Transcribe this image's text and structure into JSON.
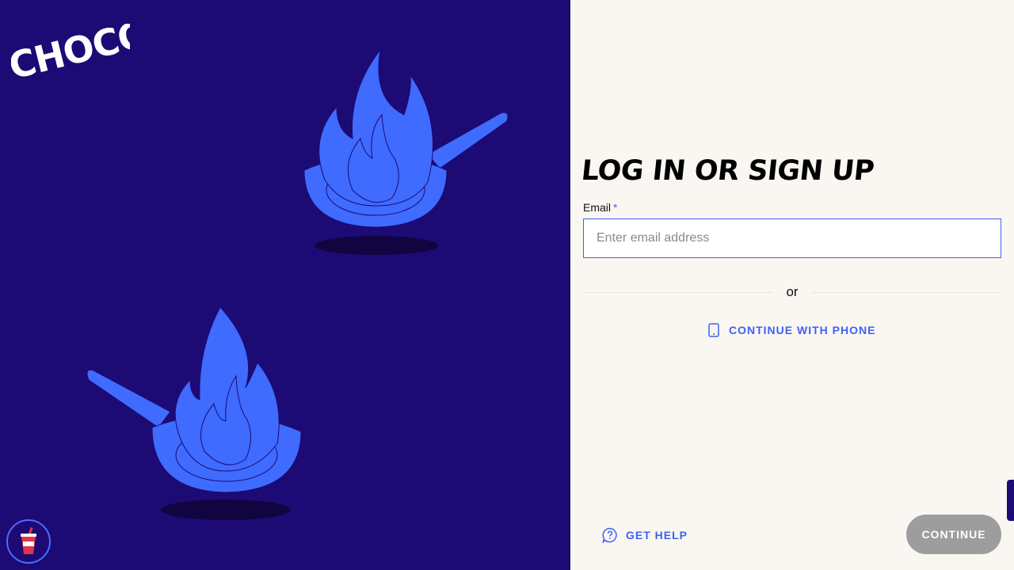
{
  "brand": {
    "logo_text": "CHOCO",
    "panel_color": "#1c0b74",
    "illustration_color": "#3f6bff"
  },
  "auth": {
    "title": "LOG IN OR SIGN UP",
    "email_label": "Email",
    "required_marker": "*",
    "email_placeholder": "Enter email address",
    "email_value": "",
    "divider_text": "or",
    "phone_label": "CONTINUE WITH PHONE",
    "phone_icon": "phone-icon"
  },
  "footer": {
    "help_label": "GET HELP",
    "help_icon": "help-chat-icon",
    "continue_label": "CONTINUE"
  },
  "widget": {
    "icon": "drink-cup-icon"
  },
  "colors": {
    "accent": "#3d62f5",
    "background": "#faf6f2",
    "disabled_button": "#9d9d9d"
  }
}
